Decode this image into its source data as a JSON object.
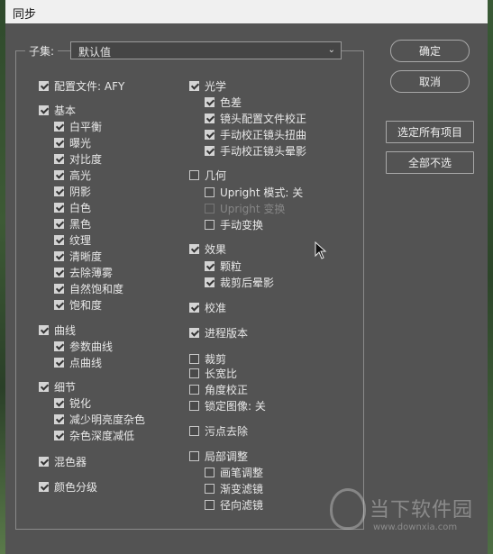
{
  "window": {
    "title": "同步"
  },
  "subset": {
    "label": "子集:",
    "value": "默认值"
  },
  "buttons": {
    "ok": "确定",
    "cancel": "取消",
    "select_all": "选定所有项目",
    "select_none": "全部不选"
  },
  "left_column": [
    {
      "id": "profile",
      "label": "配置文件: AFY",
      "checked": true,
      "indent": 0
    },
    {
      "id": "basic",
      "label": "基本",
      "checked": true,
      "indent": 0
    },
    {
      "id": "white-balance",
      "label": "白平衡",
      "checked": true,
      "indent": 1
    },
    {
      "id": "exposure",
      "label": "曝光",
      "checked": true,
      "indent": 1
    },
    {
      "id": "contrast",
      "label": "对比度",
      "checked": true,
      "indent": 1
    },
    {
      "id": "highlights",
      "label": "高光",
      "checked": true,
      "indent": 1
    },
    {
      "id": "shadows",
      "label": "阴影",
      "checked": true,
      "indent": 1
    },
    {
      "id": "whites",
      "label": "白色",
      "checked": true,
      "indent": 1
    },
    {
      "id": "blacks",
      "label": "黑色",
      "checked": true,
      "indent": 1
    },
    {
      "id": "texture",
      "label": "纹理",
      "checked": true,
      "indent": 1
    },
    {
      "id": "clarity",
      "label": "清晰度",
      "checked": true,
      "indent": 1
    },
    {
      "id": "dehaze",
      "label": "去除薄雾",
      "checked": true,
      "indent": 1
    },
    {
      "id": "vibrance",
      "label": "自然饱和度",
      "checked": true,
      "indent": 1
    },
    {
      "id": "saturation",
      "label": "饱和度",
      "checked": true,
      "indent": 1
    },
    {
      "id": "tone-curve",
      "label": "曲线",
      "checked": true,
      "indent": 0
    },
    {
      "id": "parametric-curve",
      "label": "参数曲线",
      "checked": true,
      "indent": 1
    },
    {
      "id": "point-curve",
      "label": "点曲线",
      "checked": true,
      "indent": 1
    },
    {
      "id": "detail",
      "label": "细节",
      "checked": true,
      "indent": 0
    },
    {
      "id": "sharpening",
      "label": "锐化",
      "checked": true,
      "indent": 1
    },
    {
      "id": "luminance-nr",
      "label": "减少明亮度杂色",
      "checked": true,
      "indent": 1
    },
    {
      "id": "color-nr",
      "label": "杂色深度减低",
      "checked": true,
      "indent": 1
    },
    {
      "id": "color-mixer",
      "label": "混色器",
      "checked": true,
      "indent": 0
    },
    {
      "id": "color-grading",
      "label": "颜色分级",
      "checked": true,
      "indent": 0
    }
  ],
  "right_column": [
    {
      "id": "optics",
      "label": "光学",
      "checked": true,
      "indent": 0
    },
    {
      "id": "chromatic-aberration",
      "label": "色差",
      "checked": true,
      "indent": 1
    },
    {
      "id": "lens-profile",
      "label": "镜头配置文件校正",
      "checked": true,
      "indent": 1
    },
    {
      "id": "manual-distortion",
      "label": "手动校正镜头扭曲",
      "checked": true,
      "indent": 1
    },
    {
      "id": "manual-vignette",
      "label": "手动校正镜头晕影",
      "checked": true,
      "indent": 1
    },
    {
      "id": "geometry",
      "label": "几何",
      "checked": false,
      "indent": 0
    },
    {
      "id": "upright-mode",
      "label": "Upright 模式: 关",
      "checked": false,
      "indent": 1
    },
    {
      "id": "upright-transform",
      "label": "Upright 变换",
      "checked": false,
      "indent": 1,
      "disabled": true
    },
    {
      "id": "manual-transform",
      "label": "手动变换",
      "checked": false,
      "indent": 1
    },
    {
      "id": "effects",
      "label": "效果",
      "checked": true,
      "indent": 0
    },
    {
      "id": "grain",
      "label": "颗粒",
      "checked": true,
      "indent": 1
    },
    {
      "id": "post-crop-vignette",
      "label": "裁剪后晕影",
      "checked": true,
      "indent": 1
    },
    {
      "id": "calibration",
      "label": "校准",
      "checked": true,
      "indent": 0
    },
    {
      "id": "process-version",
      "label": "进程版本",
      "checked": true,
      "indent": 0
    },
    {
      "id": "crop",
      "label": "裁剪",
      "checked": false,
      "indent": 0
    },
    {
      "id": "aspect-ratio",
      "label": "长宽比",
      "checked": false,
      "indent": 0
    },
    {
      "id": "straighten",
      "label": "角度校正",
      "checked": false,
      "indent": 0
    },
    {
      "id": "constrain-crop",
      "label": "锁定图像: 关",
      "checked": false,
      "indent": 0
    },
    {
      "id": "spot-removal",
      "label": "污点去除",
      "checked": false,
      "indent": 0
    },
    {
      "id": "local-adjustments",
      "label": "局部调整",
      "checked": false,
      "indent": 0
    },
    {
      "id": "brush",
      "label": "画笔调整",
      "checked": false,
      "indent": 1
    },
    {
      "id": "graduated-filter",
      "label": "渐变滤镜",
      "checked": false,
      "indent": 1
    },
    {
      "id": "radial-filter",
      "label": "径向滤镜",
      "checked": false,
      "indent": 1
    }
  ],
  "watermark": {
    "brand": "当下软件园",
    "url": "www.downxia.com"
  }
}
